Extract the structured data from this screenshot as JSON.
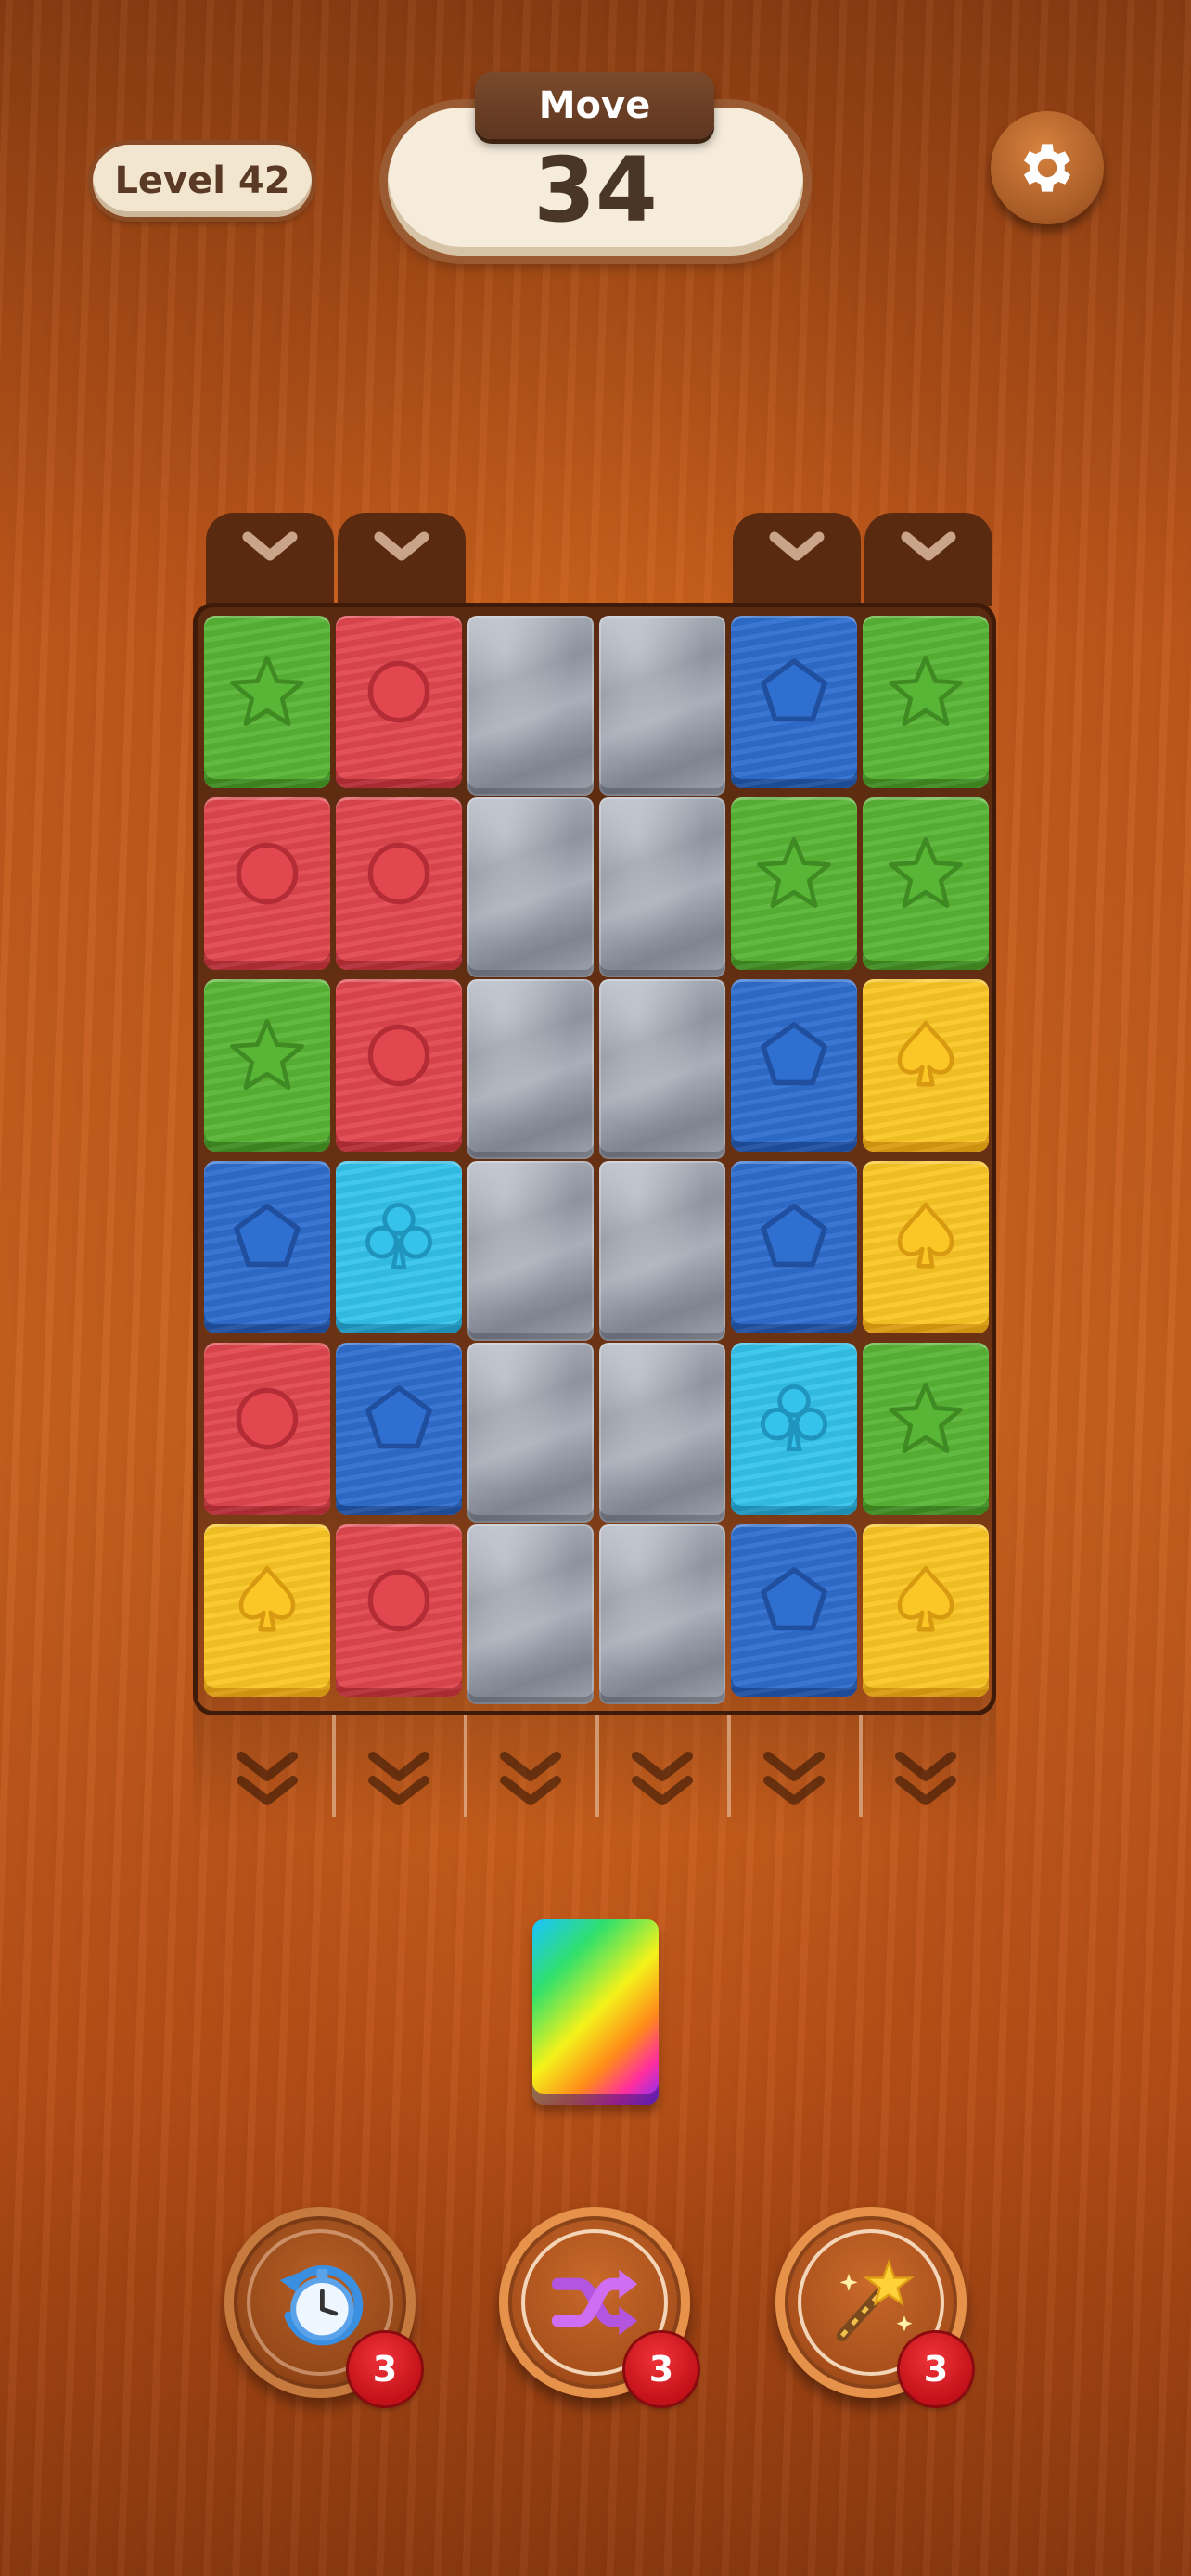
{
  "hud": {
    "level_label": "Level 42",
    "move_label": "Move",
    "move_value": "34",
    "settings_icon": "gear-icon"
  },
  "colors": {
    "green": "#58b536",
    "red": "#e2474f",
    "blue": "#2f6fcf",
    "cyan": "#35c3ec",
    "yellow": "#fbc726",
    "stone": "#9aa0aa"
  },
  "board": {
    "columns": 6,
    "rows": 6,
    "entry_columns": [
      0,
      1,
      4,
      5
    ],
    "cells": [
      [
        "green-star",
        "red-circle",
        "stone",
        "stone",
        "blue-pentagon",
        "green-star"
      ],
      [
        "red-circle",
        "red-circle",
        "stone",
        "stone",
        "green-star",
        "green-star"
      ],
      [
        "green-star",
        "red-circle",
        "stone",
        "stone",
        "blue-pentagon",
        "yellow-spade"
      ],
      [
        "blue-pentagon",
        "cyan-club",
        "stone",
        "stone",
        "blue-pentagon",
        "yellow-spade"
      ],
      [
        "red-circle",
        "blue-pentagon",
        "stone",
        "stone",
        "cyan-club",
        "green-star"
      ],
      [
        "yellow-spade",
        "red-circle",
        "stone",
        "stone",
        "blue-pentagon",
        "yellow-spade"
      ]
    ]
  },
  "next_block": "rainbow-block",
  "boosters": [
    {
      "name": "stopwatch-icon",
      "count": "3"
    },
    {
      "name": "shuffle-icon",
      "count": "3"
    },
    {
      "name": "magic-wand-icon",
      "count": "3"
    }
  ]
}
